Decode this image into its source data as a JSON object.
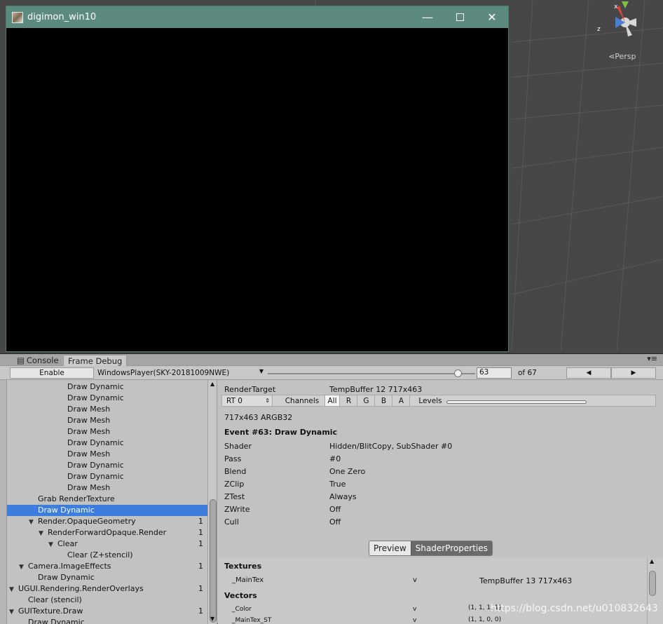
{
  "window": {
    "title": "digimon_win10"
  },
  "scene": {
    "view_mode": "Persp",
    "axis_x": "x",
    "axis_z": "z"
  },
  "tabs": [
    {
      "label": "Console"
    },
    {
      "label": "Frame Debug"
    }
  ],
  "toolbar": {
    "enable_label": "Enable",
    "player": "WindowsPlayer(SKY-20181009NWE)",
    "frame_value": "63",
    "frame_of": "of 67",
    "frame_position": 0.94,
    "prev_icon": "◀",
    "next_icon": "▶"
  },
  "tree": {
    "rows": [
      {
        "label": "Draw Dynamic",
        "count": ""
      },
      {
        "label": "Draw Dynamic",
        "count": ""
      },
      {
        "label": "Draw Mesh",
        "count": ""
      },
      {
        "label": "Draw Mesh",
        "count": ""
      },
      {
        "label": "Draw Mesh",
        "count": ""
      },
      {
        "label": "Draw Dynamic",
        "count": ""
      },
      {
        "label": "Draw Mesh",
        "count": ""
      },
      {
        "label": "Draw Dynamic",
        "count": ""
      },
      {
        "label": "Draw Dynamic",
        "count": ""
      },
      {
        "label": "Draw Mesh",
        "count": ""
      },
      {
        "label": "Grab RenderTexture",
        "count": ""
      },
      {
        "label": "Draw Dynamic",
        "count": ""
      },
      {
        "label": "Render.OpaqueGeometry",
        "count": "1"
      },
      {
        "label": "RenderForwardOpaque.Render",
        "count": "1"
      },
      {
        "label": "Clear",
        "count": "1"
      },
      {
        "label": "Clear (Z+stencil)",
        "count": ""
      },
      {
        "label": "Camera.ImageEffects",
        "count": "1"
      },
      {
        "label": "Draw Dynamic",
        "count": ""
      },
      {
        "label": "UGUI.Rendering.RenderOverlays",
        "count": "1"
      },
      {
        "label": "Clear (stencil)",
        "count": ""
      },
      {
        "label": "GUITexture.Draw",
        "count": "1"
      },
      {
        "label": "Draw Dynamic",
        "count": ""
      }
    ]
  },
  "details": {
    "render_target_label": "RenderTarget",
    "render_target_value": "TempBuffer 12 717x463",
    "rt_select": "RT 0",
    "channels_label": "Channels",
    "channels": [
      "All",
      "R",
      "G",
      "B",
      "A"
    ],
    "levels_label": "Levels",
    "format": "717x463 ARGB32",
    "event_title": "Event #63: Draw Dynamic",
    "props": [
      {
        "k": "Shader",
        "v": "Hidden/BlitCopy, SubShader #0"
      },
      {
        "k": "Pass",
        "v": "#0"
      },
      {
        "k": "Blend",
        "v": "One Zero"
      },
      {
        "k": "ZClip",
        "v": "True"
      },
      {
        "k": "ZTest",
        "v": "Always"
      },
      {
        "k": "ZWrite",
        "v": "Off"
      },
      {
        "k": "Cull",
        "v": "Off"
      }
    ],
    "preview_label": "Preview",
    "shader_props_label": "ShaderProperties"
  },
  "shader_properties": {
    "textures_heading": "Textures",
    "main_tex_name": "_MainTex",
    "main_tex_stage": "v",
    "main_tex_value": "TempBuffer 13 717x463",
    "vectors_heading": "Vectors",
    "color_name": "_Color",
    "color_stage": "v",
    "color_value": "(1, 1, 1, 1)",
    "st_name": "_MainTex_ST",
    "st_stage": "v",
    "st_value": "(1, 1, 0, 0)"
  },
  "watermark": "https://blog.csdn.net/u010832643"
}
